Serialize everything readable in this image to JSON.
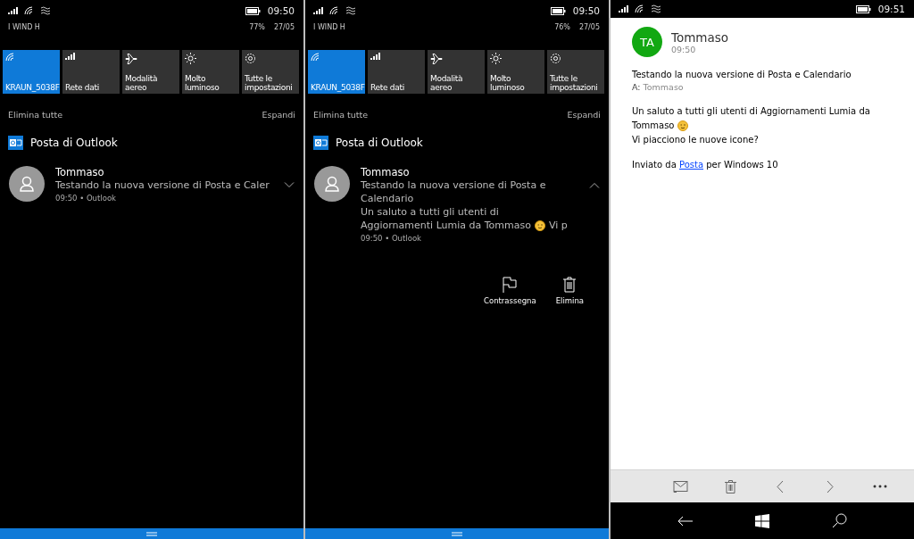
{
  "screens": [
    {
      "kind": "action_center",
      "status": {
        "time": "09:50",
        "carrier": "I WIND H",
        "battery": "77%",
        "date": "27/05"
      },
      "tiles": [
        {
          "kind": "wifi",
          "label": "KRAUN_5038F",
          "on": true
        },
        {
          "kind": "cellular",
          "label": "Rete dati",
          "on": false
        },
        {
          "kind": "airplane",
          "label": "Modalità aereo",
          "on": false
        },
        {
          "kind": "brightness",
          "label": "Molto luminoso",
          "on": false
        },
        {
          "kind": "settings",
          "label": "Tutte le impostazioni",
          "on": false
        }
      ],
      "clear_all": "Elimina tutte",
      "expand": "Espandi",
      "app": "Posta di Outlook",
      "notification": {
        "sender": "Tommaso",
        "expanded": false,
        "lines": [
          [
            "Testando la nuova versione di Posta e Caler"
          ]
        ],
        "meta": "09:50 • Outlook"
      }
    },
    {
      "kind": "action_center",
      "status": {
        "time": "09:50",
        "carrier": "I WIND H",
        "battery": "76%",
        "date": "27/05"
      },
      "tiles": [
        {
          "kind": "wifi",
          "label": "KRAUN_5038F",
          "on": true
        },
        {
          "kind": "cellular",
          "label": "Rete dati",
          "on": false
        },
        {
          "kind": "airplane",
          "label": "Modalità aereo",
          "on": false
        },
        {
          "kind": "brightness",
          "label": "Molto luminoso",
          "on": false
        },
        {
          "kind": "settings",
          "label": "Tutte le impostazioni",
          "on": false
        }
      ],
      "clear_all": "Elimina tutte",
      "expand": "Espandi",
      "app": "Posta di Outlook",
      "notification": {
        "sender": "Tommaso",
        "expanded": true,
        "lines": [
          [
            "Testando la nuova versione di Posta e"
          ],
          [
            "Calendario"
          ],
          [
            "Un saluto a tutti gli utenti di"
          ],
          [
            "Aggiornamenti Lumia da Tommaso",
            "Vi p"
          ]
        ],
        "meta": "09:50 • Outlook",
        "actions": [
          {
            "kind": "flag",
            "label": "Contrassegna"
          },
          {
            "kind": "delete",
            "label": "Elimina"
          }
        ]
      }
    },
    {
      "kind": "mail_reader",
      "status": {
        "time": "09:51"
      },
      "mail": {
        "initials": "TA",
        "sender": "Tommaso",
        "time": "09:50",
        "subject": "Testando la nuova versione di Posta e Calendario",
        "to_label": "A:",
        "to": "Tommaso",
        "body": [
          "Un saluto a tutti gli utenti di Aggiornamenti Lumia da",
          "Tommaso"
        ],
        "question": "Vi piacciono le nuove icone?",
        "signature": {
          "before": "Inviato da",
          "link": "Posta",
          "after": "per Windows 10"
        }
      }
    }
  ]
}
